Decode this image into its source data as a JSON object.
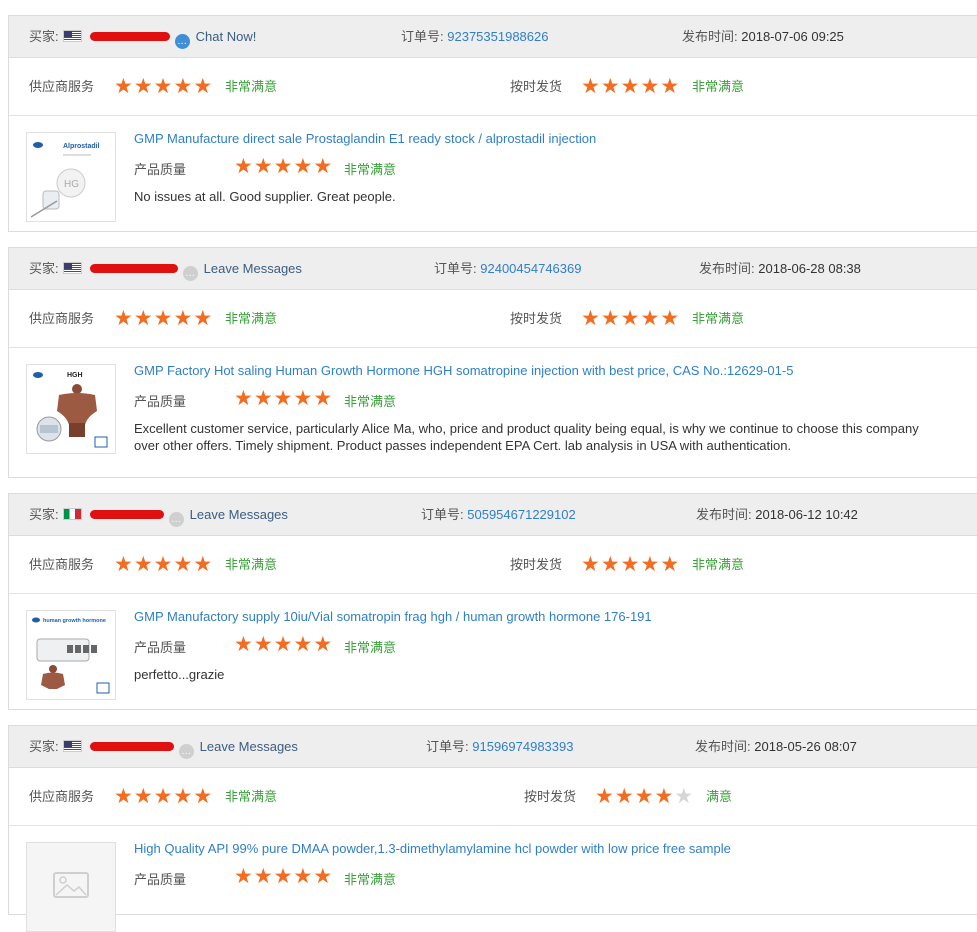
{
  "labels": {
    "buyer": "买家:",
    "order": "订单号:",
    "date": "发布时间:",
    "supplier_service": "供应商服务",
    "on_time": "按时发货",
    "quality": "产品质量",
    "star": "★"
  },
  "reviews": [
    {
      "flag": "us",
      "action": "Chat Now!",
      "action_icon": "chat-icon",
      "order_no": "92375351988626",
      "date": "2018-07-06 09:25",
      "supplier_stars": 5,
      "supplier_grade": "非常满意",
      "ontime_stars": 5,
      "ontime_grade": "非常满意",
      "product_title": "GMP Manufacture direct sale Prostaglandin E1 ready stock / alprostadil injection",
      "quality_stars": 5,
      "quality_grade": "非常满意",
      "review_text": "No issues at all. Good supplier. Great people.",
      "thumb_label": "Alprostadil",
      "thumb_badge": "HG"
    },
    {
      "flag": "us",
      "action": "Leave Messages",
      "action_icon": "message-icon",
      "order_no": "92400454746369",
      "date": "2018-06-28 08:38",
      "supplier_stars": 5,
      "supplier_grade": "非常满意",
      "ontime_stars": 5,
      "ontime_grade": "非常满意",
      "product_title": "GMP Factory Hot saling Human Growth Hormone HGH somatropine injection with best price, CAS No.:12629-01-5",
      "quality_stars": 5,
      "quality_grade": "非常满意",
      "review_text": "Excellent customer service, particularly Alice Ma, who, price and product quality being equal, is why we continue to choose this company over other offers. Timely shipment. Product passes independent EPA Cert. lab analysis in USA with authentication.",
      "thumb_label": "HGH",
      "thumb_badge": ""
    },
    {
      "flag": "it",
      "action": "Leave Messages",
      "action_icon": "message-icon",
      "order_no": "505954671229102",
      "date": "2018-06-12 10:42",
      "supplier_stars": 5,
      "supplier_grade": "非常满意",
      "ontime_stars": 5,
      "ontime_grade": "非常满意",
      "product_title": "GMP Manufactory supply 10iu/Vial somatropin frag hgh / human growth hormone 176-191",
      "quality_stars": 5,
      "quality_grade": "非常满意",
      "review_text": "perfetto...grazie",
      "thumb_label": "human growth hormone",
      "thumb_badge": ""
    },
    {
      "flag": "us",
      "action": "Leave Messages",
      "action_icon": "message-icon",
      "order_no": "91596974983393",
      "date": "2018-05-26 08:07",
      "supplier_stars": 5,
      "supplier_grade": "非常满意",
      "ontime_stars": 4,
      "ontime_grade": "满意",
      "product_title": "High Quality API 99% pure DMAA powder,1.3-dimethylamylamine hcl powder with low price free sample",
      "quality_stars": 5,
      "quality_grade": "非常满意",
      "review_text": "",
      "thumb_label": "",
      "thumb_badge": ""
    }
  ]
}
